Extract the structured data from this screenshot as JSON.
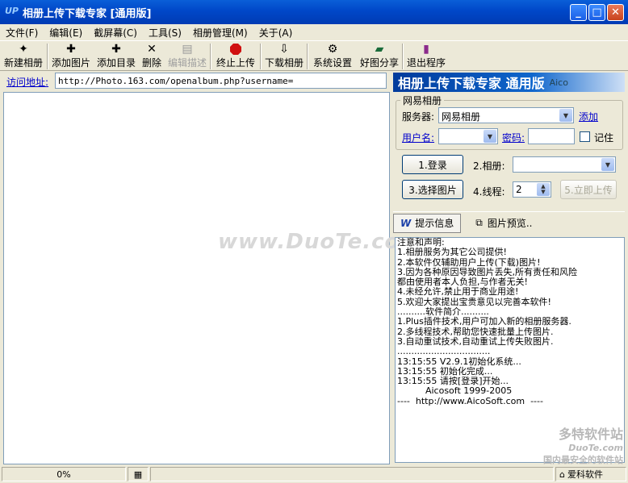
{
  "window": {
    "title": "相册上传下载专家 [通用版]",
    "app_icon_text": "UP"
  },
  "menu": [
    "文件(F)",
    "编辑(E)",
    "截屏幕(C)",
    "工具(S)",
    "相册管理(M)",
    "关于(A)"
  ],
  "toolbar": {
    "new_album": "新建相册",
    "add_picture": "添加图片",
    "add_folder": "添加目录",
    "delete": "删除",
    "edit_desc": "编辑描述",
    "stop_upload": "终止上传",
    "download_album": "下载相册",
    "settings": "系统设置",
    "share": "好图分享",
    "exit": "退出程序"
  },
  "address": {
    "label": "访问地址:",
    "value": "http://Photo.163.com/openalbum.php?username="
  },
  "banner": {
    "title": "相册上传下载专家 通用版",
    "sub": "Aico"
  },
  "account_group": {
    "title": "网易相册",
    "server_label": "服务器:",
    "server_value": "网易相册",
    "add_link": "添加",
    "username_label": "用户名:",
    "username_value": "",
    "password_label": "密码:",
    "password_value": "",
    "remember_label": "记住"
  },
  "actions": {
    "login": "1.登录",
    "album_label": "2.相册:",
    "album_value": "",
    "select_pictures": "3.选择图片",
    "threads_label": "4.线程:",
    "threads_value": "2",
    "upload_now": "5.立即上传"
  },
  "tabs": {
    "info": "提示信息",
    "preview": "图片预览.."
  },
  "log": [
    "注意和声明:",
    "1.相册服务为其它公司提供!",
    "2.本软件仅辅助用户上传(下载)图片!",
    "3.因为各种原因导致图片丢失,所有责任和风险",
    "都由使用者本人负担,与作者无关!",
    "4.未经允许,禁止用于商业用途!",
    "5.欢迎大家提出宝贵意见以完善本软件!",
    "",
    "..........软件简介..........",
    "1.Plus插件技术,用户可加入新的相册服务器.",
    "2.多线程技术,帮助您快速批量上传图片.",
    "3.自动重试技术,自动重试上传失败图片.",
    ".................................",
    "",
    "13:15:55 V2.9.1初始化系统...",
    "13:15:55 初始化完成...",
    "13:15:55 请按[登录]开始...",
    "",
    "          Aicosoft 1999-2005",
    "----  http://www.AicoSoft.com  ----"
  ],
  "watermark": "www.DuoTe.com",
  "corner_watermark": {
    "line1": "多特软件站",
    "line2": "DuoTe.com",
    "line3": "国内最安全的软件站"
  },
  "status": {
    "progress": "0%",
    "progress_fraction": 0,
    "company": "爱科软件"
  }
}
